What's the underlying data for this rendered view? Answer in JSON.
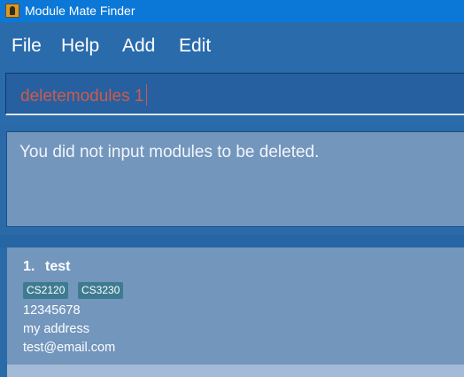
{
  "window": {
    "title": "Module Mate Finder",
    "icon": "app-icon"
  },
  "menu": {
    "items": [
      "File",
      "Help",
      "Add",
      "Edit"
    ]
  },
  "command_box": {
    "value": "deletemodules 1",
    "text_color": "#cf5a4c"
  },
  "result_display": {
    "text": "You did not input modules to be deleted."
  },
  "person_list": [
    {
      "index": "1.",
      "name": "test",
      "tags": [
        "CS2120",
        "CS3230"
      ],
      "phone": "12345678",
      "address": "my address",
      "email": "test@email.com"
    }
  ],
  "colors": {
    "title_bar": "#0b78d7",
    "background": "#2a6bab",
    "panel": "#7396bd",
    "tag": "#3e7b91"
  }
}
